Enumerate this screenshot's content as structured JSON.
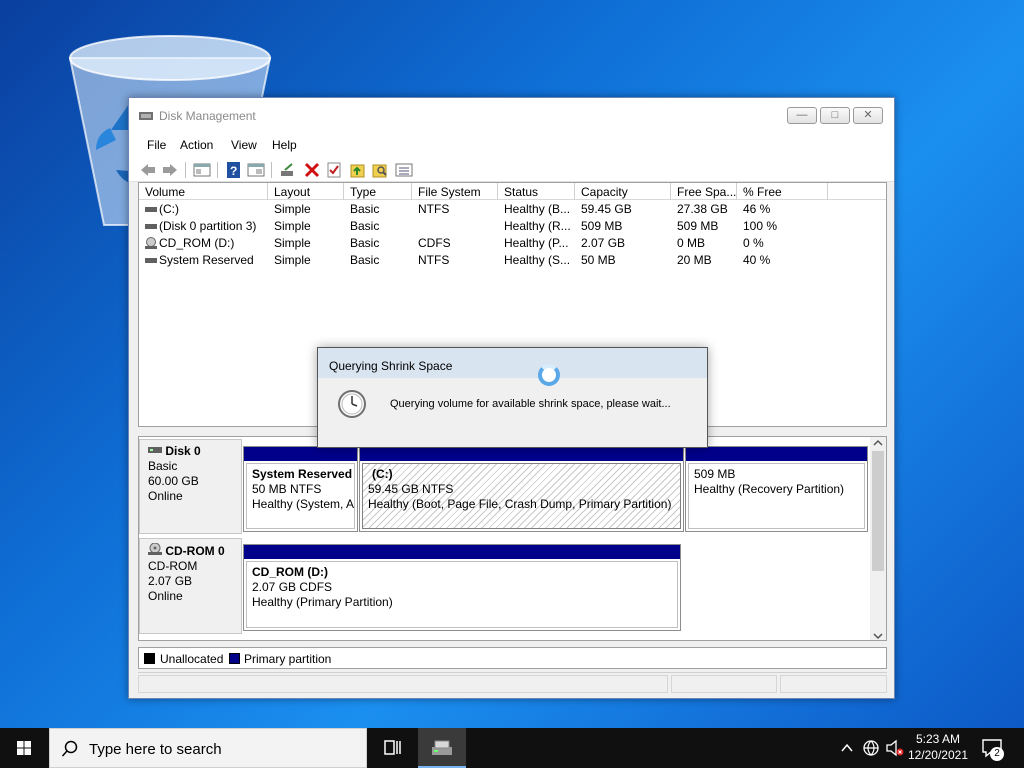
{
  "window": {
    "title": "Disk Management",
    "menu": [
      "File",
      "Action",
      "View",
      "Help"
    ]
  },
  "volume_list": {
    "columns": [
      "Volume",
      "Layout",
      "Type",
      "File System",
      "Status",
      "Capacity",
      "Free Spa...",
      "% Free"
    ],
    "rows": [
      [
        "(C:)",
        "Simple",
        "Basic",
        "NTFS",
        "Healthy (B...",
        "59.45 GB",
        "27.38 GB",
        "46 %"
      ],
      [
        "(Disk 0 partition 3)",
        "Simple",
        "Basic",
        "",
        "Healthy (R...",
        "509 MB",
        "509 MB",
        "100 %"
      ],
      [
        "CD_ROM (D:)",
        "Simple",
        "Basic",
        "CDFS",
        "Healthy (P...",
        "2.07 GB",
        "0 MB",
        "0 %"
      ],
      [
        "System Reserved",
        "Simple",
        "Basic",
        "NTFS",
        "Healthy (S...",
        "50 MB",
        "20 MB",
        "40 %"
      ]
    ]
  },
  "disks": [
    {
      "name": "Disk 0",
      "type": "Basic",
      "size": "60.00 GB",
      "state": "Online",
      "partitions": [
        {
          "title": "System Reserved",
          "line2": "50 MB NTFS",
          "line3": "Healthy (System, A"
        },
        {
          "title": "(C:)",
          "line2": "59.45 GB NTFS",
          "line3": "Healthy (Boot, Page File, Crash Dump, Primary Partition)"
        },
        {
          "title": "",
          "line2": "509 MB",
          "line3": "Healthy (Recovery Partition)"
        }
      ]
    },
    {
      "name": "CD-ROM 0",
      "type": "CD-ROM",
      "size": "2.07 GB",
      "state": "Online",
      "partitions": [
        {
          "title": "CD_ROM  (D:)",
          "line2": "2.07 GB CDFS",
          "line3": "Healthy (Primary Partition)"
        }
      ]
    }
  ],
  "legend": {
    "unallocated": "Unallocated",
    "primary": "Primary partition",
    "unallocated_color": "#000000",
    "primary_color": "#00008b"
  },
  "dialog": {
    "title": "Querying Shrink Space",
    "message": "Querying volume for available shrink space, please wait..."
  },
  "taskbar": {
    "search_placeholder": "Type here to search",
    "time": "5:23 AM",
    "date": "12/20/2021",
    "notification_count": "2"
  }
}
